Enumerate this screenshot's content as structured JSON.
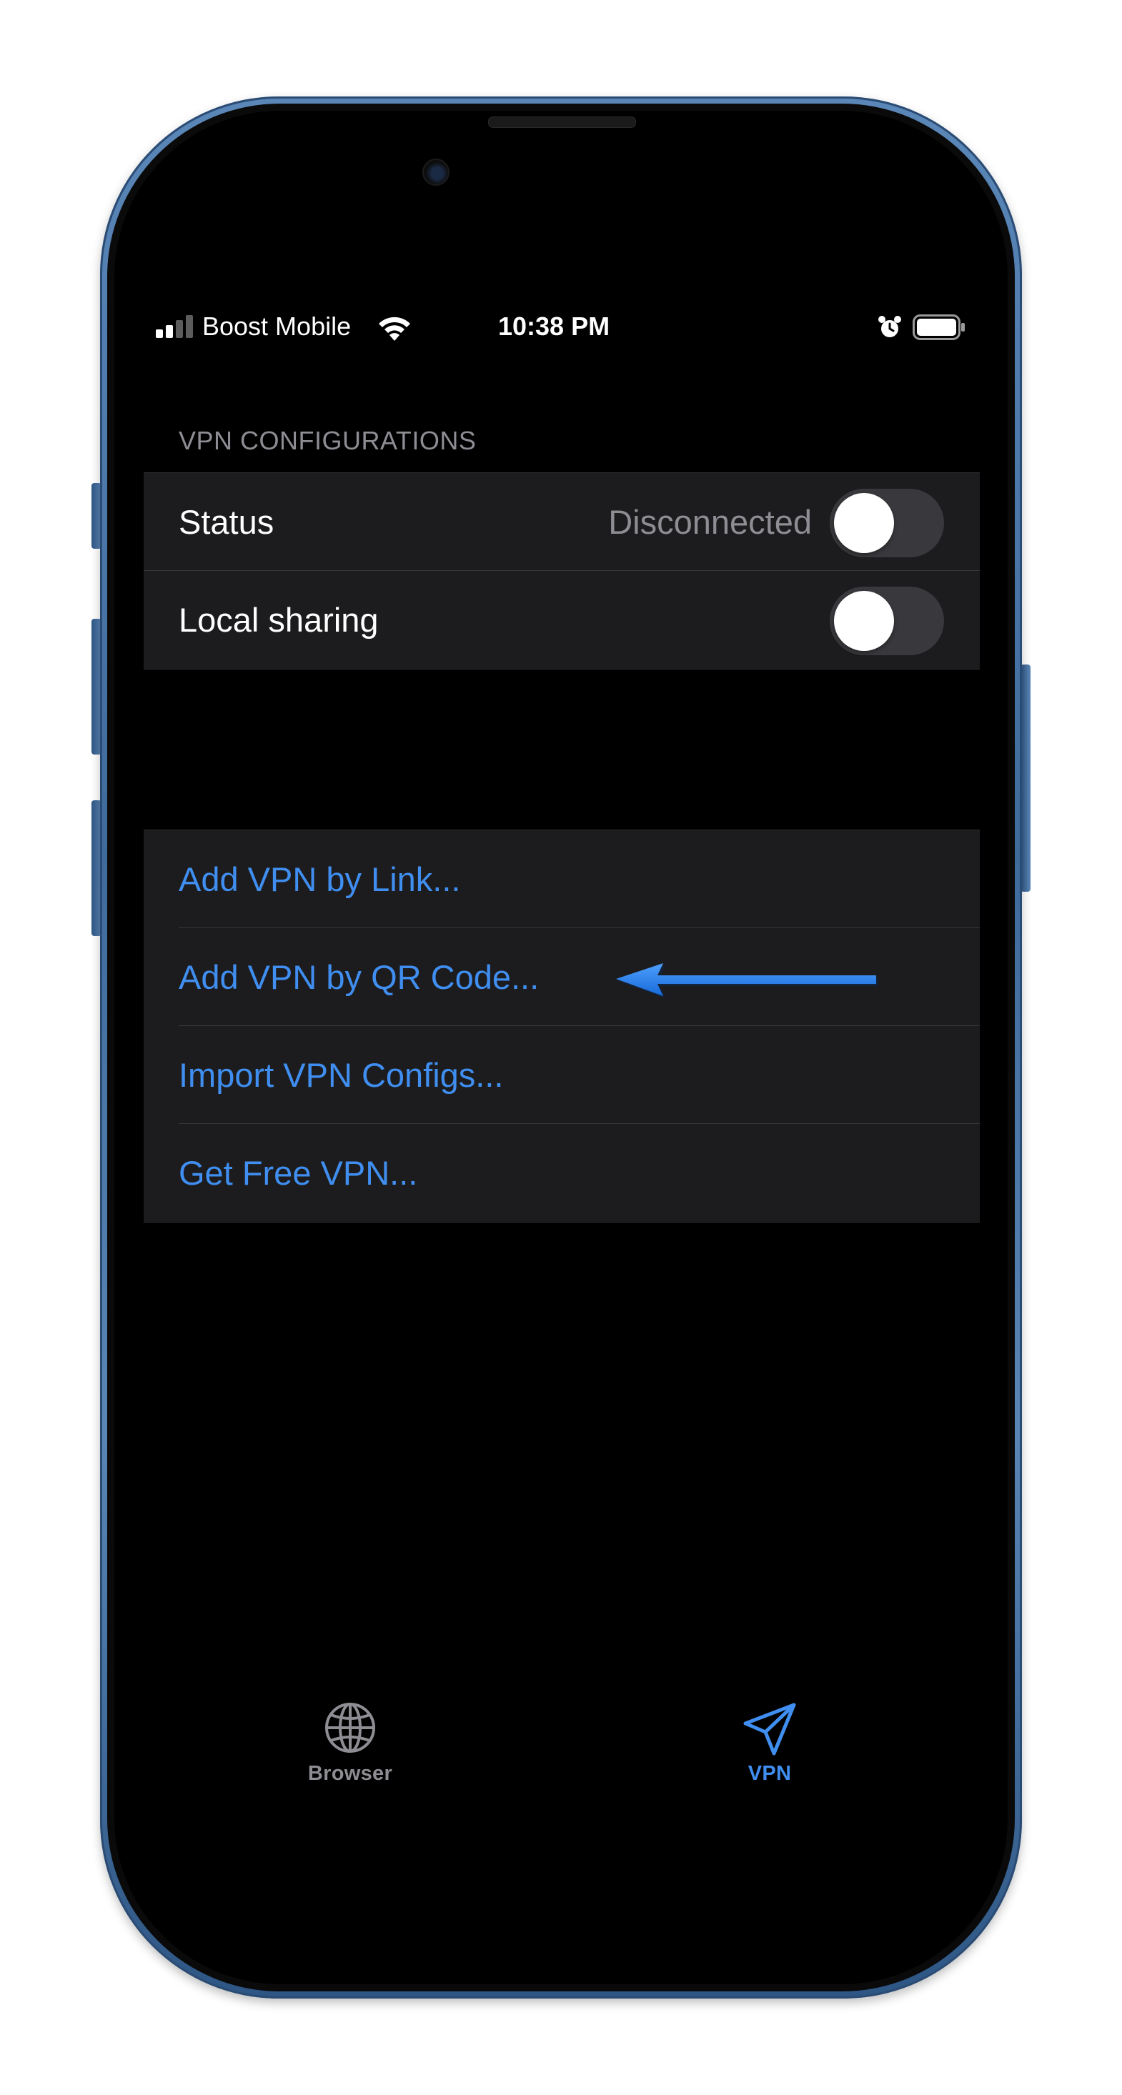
{
  "status_bar": {
    "carrier": "Boost Mobile",
    "time": "10:38 PM",
    "signal_icon": "signal-bars-icon",
    "wifi_icon": "wifi-icon",
    "alarm_icon": "alarm-clock-icon",
    "battery_icon": "battery-icon"
  },
  "vpn_section": {
    "header": "VPN CONFIGURATIONS",
    "rows": [
      {
        "label": "Status",
        "value": "Disconnected",
        "toggle_on": false
      },
      {
        "label": "Local sharing",
        "toggle_on": false
      }
    ]
  },
  "actions": {
    "items": [
      {
        "label": "Add VPN by Link..."
      },
      {
        "label": "Add VPN by QR Code..."
      },
      {
        "label": "Import VPN Configs..."
      },
      {
        "label": "Get Free VPN..."
      }
    ]
  },
  "annotation": {
    "arrow_color": "#1f7ef0",
    "arrow_icon": "left-arrow-icon"
  },
  "tab_bar": {
    "tabs": [
      {
        "label": "Browser",
        "icon": "globe-icon",
        "selected": false
      },
      {
        "label": "VPN",
        "icon": "paper-plane-icon",
        "selected": true
      }
    ],
    "active_color": "#3f8ef0",
    "inactive_color": "#8d8d93"
  },
  "colors": {
    "link": "#3f8ef0",
    "cell_background": "#1c1c1e",
    "secondary_text": "#8d8d93",
    "frame": "#4a77aa"
  }
}
